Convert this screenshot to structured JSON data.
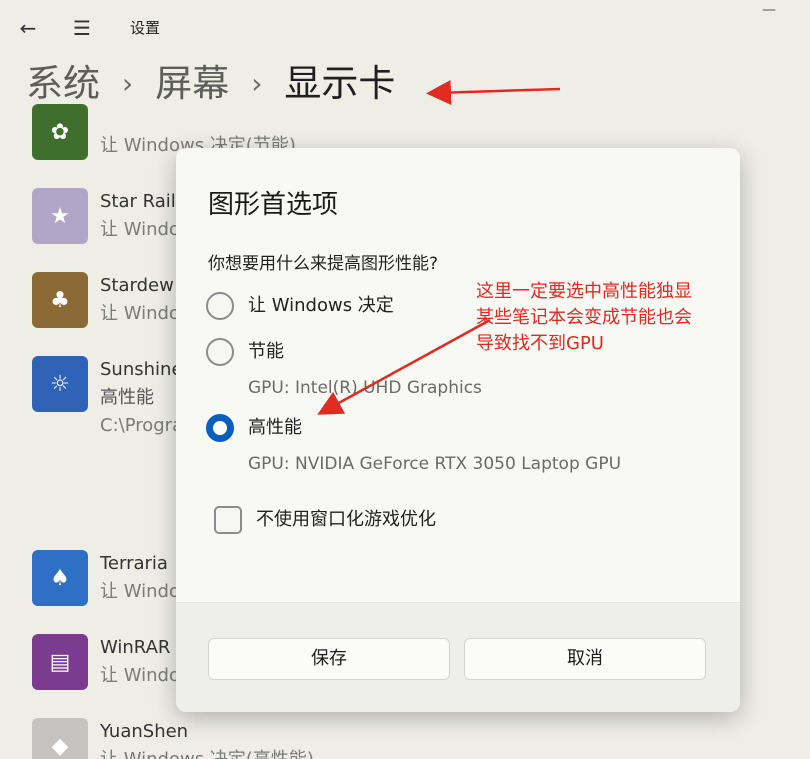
{
  "window": {
    "back_icon": "←",
    "menu_icon": "☰",
    "title": "设置",
    "minimize_icon": "—"
  },
  "breadcrumb": {
    "part1": "系统",
    "sep1": "›",
    "part2": "屏幕",
    "sep2": "›",
    "current": "显示卡"
  },
  "apps": [
    {
      "name": "",
      "sub": "让 Windows 决定(节能)",
      "icon": "plant-zombie-icon",
      "icon_color": "#3f6f2c"
    },
    {
      "name": "Star Rail",
      "sub": "让 Windo",
      "icon": "star-rail-icon",
      "icon_color": "#b2a6c8"
    },
    {
      "name": "Stardew",
      "sub": "让 Windo",
      "icon": "stardew-icon",
      "icon_color": "#8b6a36"
    },
    {
      "name": "Sunshine",
      "sub": "高性能",
      "sub2": "C:\\Progra",
      "icon": "sunshine-icon",
      "icon_color": "#2f63b8"
    },
    {
      "name": "Terraria",
      "sub": "让 Windo",
      "icon": "terraria-icon",
      "icon_color": "#2f70c6"
    },
    {
      "name": "WinRAR",
      "sub": "让 Windo",
      "icon": "winrar-icon",
      "icon_color": "#7b3c8f"
    },
    {
      "name": "YuanShen",
      "sub": "让 Windows 决定(高性能)",
      "icon": "yuanshen-icon",
      "icon_color": "#c7c3c0"
    }
  ],
  "dialog": {
    "title": "图形首选项",
    "question": "你想要用什么来提高图形性能?",
    "options": [
      {
        "label": "让 Windows 决定",
        "checked": false
      },
      {
        "label": "节能",
        "checked": false,
        "gpu": "GPU: Intel(R) UHD Graphics"
      },
      {
        "label": "高性能",
        "checked": true,
        "gpu": "GPU: NVIDIA GeForce RTX 3050 Laptop GPU"
      }
    ],
    "checkbox_label": "不使用窗口化游戏优化",
    "checkbox_checked": false,
    "save_label": "保存",
    "cancel_label": "取消"
  },
  "annotation": {
    "line1": "这里一定要选中高性能独显",
    "line2": "某些笔记本会变成节能也会",
    "line3": "导致找不到GPU",
    "color": "#e12a20"
  }
}
